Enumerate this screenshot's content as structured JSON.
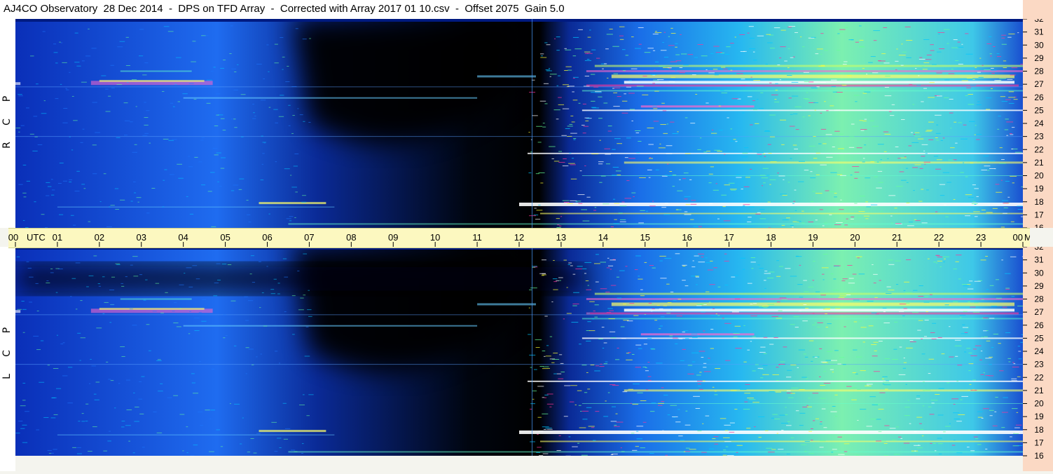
{
  "title": "AJ4CO Observatory  28 Dec 2014  -  DPS on TFD Array  -  Corrected with Array 2017 01 10.csv  -  Offset 2075  Gain 5.0",
  "panels": [
    {
      "id": "rcp",
      "letters": [
        "R",
        "C",
        "P"
      ]
    },
    {
      "id": "lcp",
      "letters": [
        "L",
        "C",
        "P"
      ]
    }
  ],
  "time_axis": {
    "labels": [
      "00",
      "01",
      "02",
      "03",
      "04",
      "05",
      "06",
      "07",
      "08",
      "09",
      "10",
      "11",
      "12",
      "13",
      "14",
      "15",
      "16",
      "17",
      "18",
      "19",
      "20",
      "21",
      "22",
      "23",
      "00"
    ],
    "utc_label": "UTC",
    "mhz_label": "MHz"
  },
  "colors": {
    "colormap": [
      "#000000",
      "#001060",
      "#0033cc",
      "#1e78ff",
      "#00c8ff",
      "#66ff99",
      "#ffff33",
      "#ff3399",
      "#ffffff"
    ],
    "time_axis_bg": "#fcf8c0",
    "freq_axis_bg": "#fbd9c4"
  },
  "chart_data": {
    "type": "heatmap",
    "title": "AJ4CO Observatory  28 Dec 2014  -  DPS on TFD Array  -  Corrected with Array 2017 01 10.csv  -  Offset 2075  Gain 5.0",
    "x": {
      "label": "UTC",
      "range": [
        0,
        24
      ],
      "ticks": [
        0,
        1,
        2,
        3,
        4,
        5,
        6,
        7,
        8,
        9,
        10,
        11,
        12,
        13,
        14,
        15,
        16,
        17,
        18,
        19,
        20,
        21,
        22,
        23,
        24
      ]
    },
    "y": {
      "label": "MHz",
      "range": [
        16,
        32
      ],
      "ticks": [
        16,
        17,
        18,
        19,
        20,
        21,
        22,
        23,
        24,
        25,
        26,
        27,
        28,
        29,
        30,
        31,
        32
      ]
    },
    "panels": [
      {
        "name": "R C P",
        "position": "top"
      },
      {
        "name": "L C P",
        "position": "bottom"
      }
    ],
    "grid": false,
    "legend": "none"
  }
}
